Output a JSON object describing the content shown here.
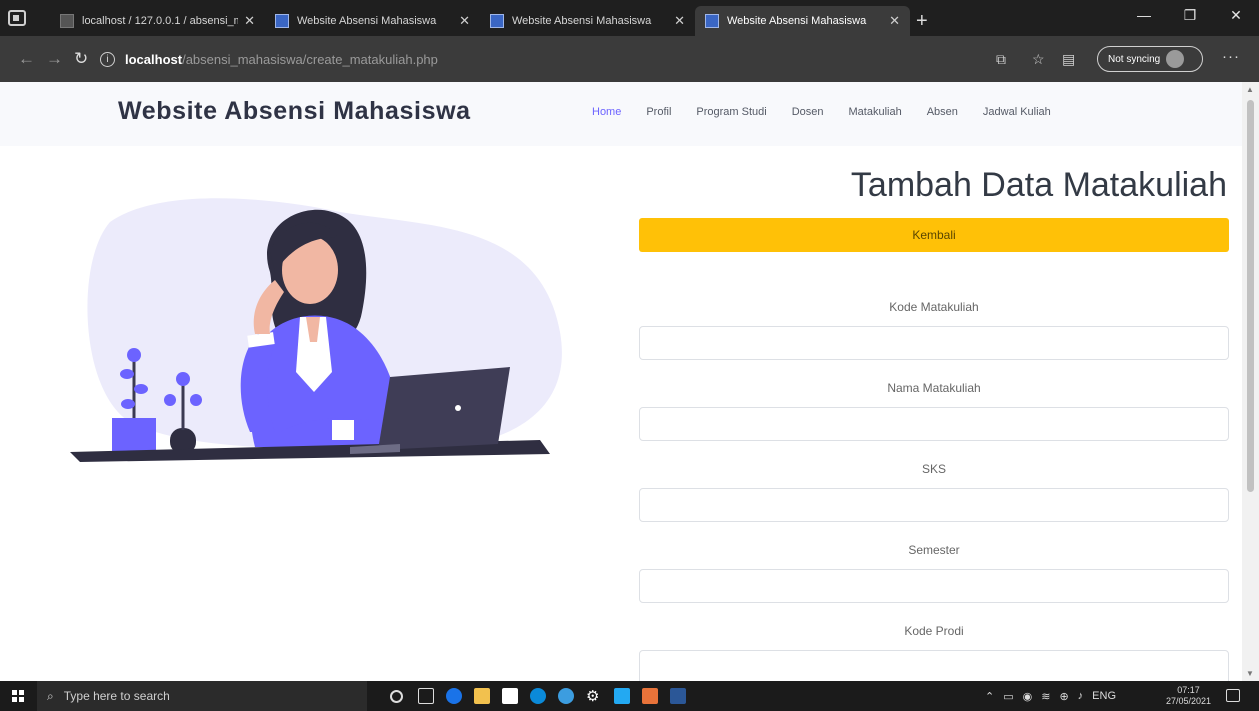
{
  "browser": {
    "tabs": [
      {
        "label": "localhost / 127.0.0.1 / absensi_m",
        "active": false
      },
      {
        "label": "Website Absensi Mahasiswa",
        "active": false
      },
      {
        "label": "Website Absensi Mahasiswa",
        "active": false
      },
      {
        "label": "Website Absensi Mahasiswa",
        "active": true
      }
    ],
    "url_host": "localhost",
    "url_path": "/absensi_mahasiswa/create_matakuliah.php",
    "sync_label": "Not syncing"
  },
  "site": {
    "brand": "Website Absensi Mahasiswa",
    "menu": [
      "Home",
      "Profil",
      "Program Studi",
      "Dosen",
      "Matakuliah",
      "Absen",
      "Jadwal Kuliah"
    ],
    "active_menu": "Home",
    "accent": "#6c63ff"
  },
  "form": {
    "title": "Tambah Data Matakuliah",
    "back_label": "Kembali",
    "back_color": "#ffc107",
    "fields": [
      {
        "label": "Kode Matakuliah",
        "value": ""
      },
      {
        "label": "Nama Matakuliah",
        "value": ""
      },
      {
        "label": "SKS",
        "value": ""
      },
      {
        "label": "Semester",
        "value": ""
      },
      {
        "label": "Kode Prodi",
        "value": ""
      }
    ]
  },
  "taskbar": {
    "search_placeholder": "Type here to search",
    "lang": "ENG",
    "time": "07:17",
    "date": "27/05/2021"
  }
}
